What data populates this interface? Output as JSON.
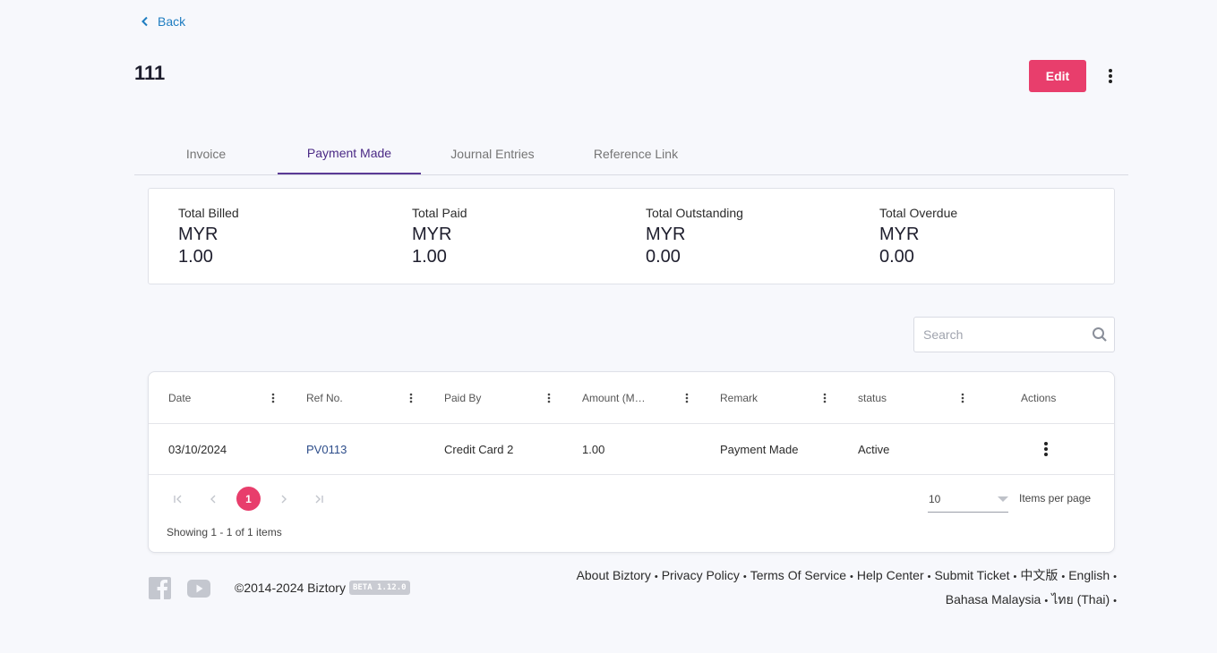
{
  "nav": {
    "back_label": "Back"
  },
  "header": {
    "title": "111",
    "edit_label": "Edit"
  },
  "tabs": [
    {
      "label": "Invoice"
    },
    {
      "label": "Payment Made"
    },
    {
      "label": "Journal Entries"
    },
    {
      "label": "Reference Link"
    }
  ],
  "summary": [
    {
      "label": "Total Billed",
      "currency": "MYR",
      "value": "1.00"
    },
    {
      "label": "Total Paid",
      "currency": "MYR",
      "value": "1.00"
    },
    {
      "label": "Total Outstanding",
      "currency": "MYR",
      "value": "0.00"
    },
    {
      "label": "Total Overdue",
      "currency": "MYR",
      "value": "0.00"
    }
  ],
  "search": {
    "placeholder": "Search"
  },
  "table": {
    "columns": [
      "Date",
      "Ref No.",
      "Paid By",
      "Amount (M…",
      "Remark",
      "status",
      "Actions"
    ],
    "rows": [
      {
        "date": "03/10/2024",
        "ref": "PV0113",
        "paid_by": "Credit Card 2",
        "amount": "1.00",
        "remark": "Payment Made",
        "status": "Active"
      }
    ]
  },
  "pagination": {
    "current_page": "1",
    "per_page": "10",
    "per_page_label": "Items per page",
    "showing": "Showing 1 - 1 of 1 items"
  },
  "footer": {
    "copyright": "©2014-2024 Biztory",
    "version": "BETA 1.12.0",
    "links_line1": [
      "About Biztory",
      "Privacy Policy",
      "Terms Of Service",
      "Help Center",
      "Submit Ticket",
      "中文版",
      "English"
    ],
    "links_line2": [
      "Bahasa Malaysia",
      "ไทย (Thai)"
    ]
  },
  "colors": {
    "accent": "#e83e6c",
    "tab_active": "#4b2a86",
    "link": "#1f7dc1"
  }
}
